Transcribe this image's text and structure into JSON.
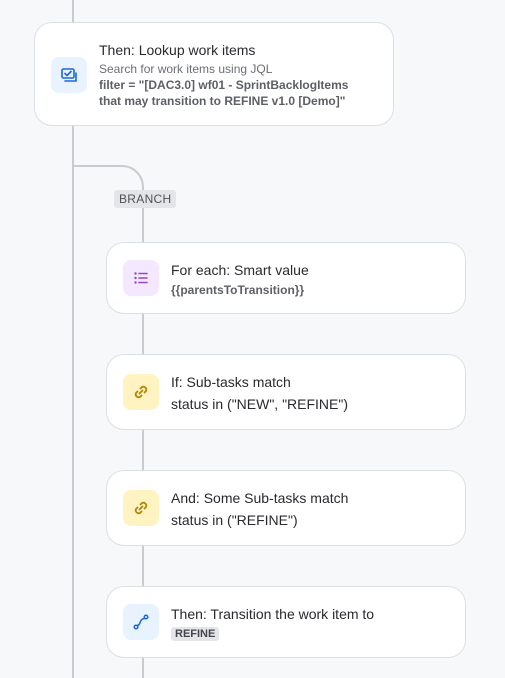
{
  "cards": {
    "lookup": {
      "title": "Then: Lookup work items",
      "subtitle": "Search for work items using JQL",
      "filter_line1": "filter = \"[DAC3.0] wf01 - SprintBacklogItems",
      "filter_line2": "that may transition to REFINE v1.0 [Demo]\"",
      "icon": "search-work-items-icon"
    },
    "foreach": {
      "title": "For each: Smart value",
      "value": "{{parentsToTransition}}",
      "icon": "list-icon"
    },
    "if_subtasks": {
      "title": "If: Sub-tasks match",
      "condition": "status in (\"NEW\", \"REFINE\")",
      "icon": "link-icon"
    },
    "and_subtasks": {
      "title": "And: Some Sub-tasks match",
      "condition": "status in (\"REFINE\")",
      "icon": "link-icon"
    },
    "transition": {
      "title": "Then: Transition the work item to",
      "status": "REFINE",
      "icon": "transition-icon"
    }
  },
  "branch_label": "BRANCH",
  "colors": {
    "blue_icon": "#1868db",
    "purple_icon": "#964ac0",
    "yellow_icon": "#b38600",
    "connector": "#c9cbcf"
  }
}
